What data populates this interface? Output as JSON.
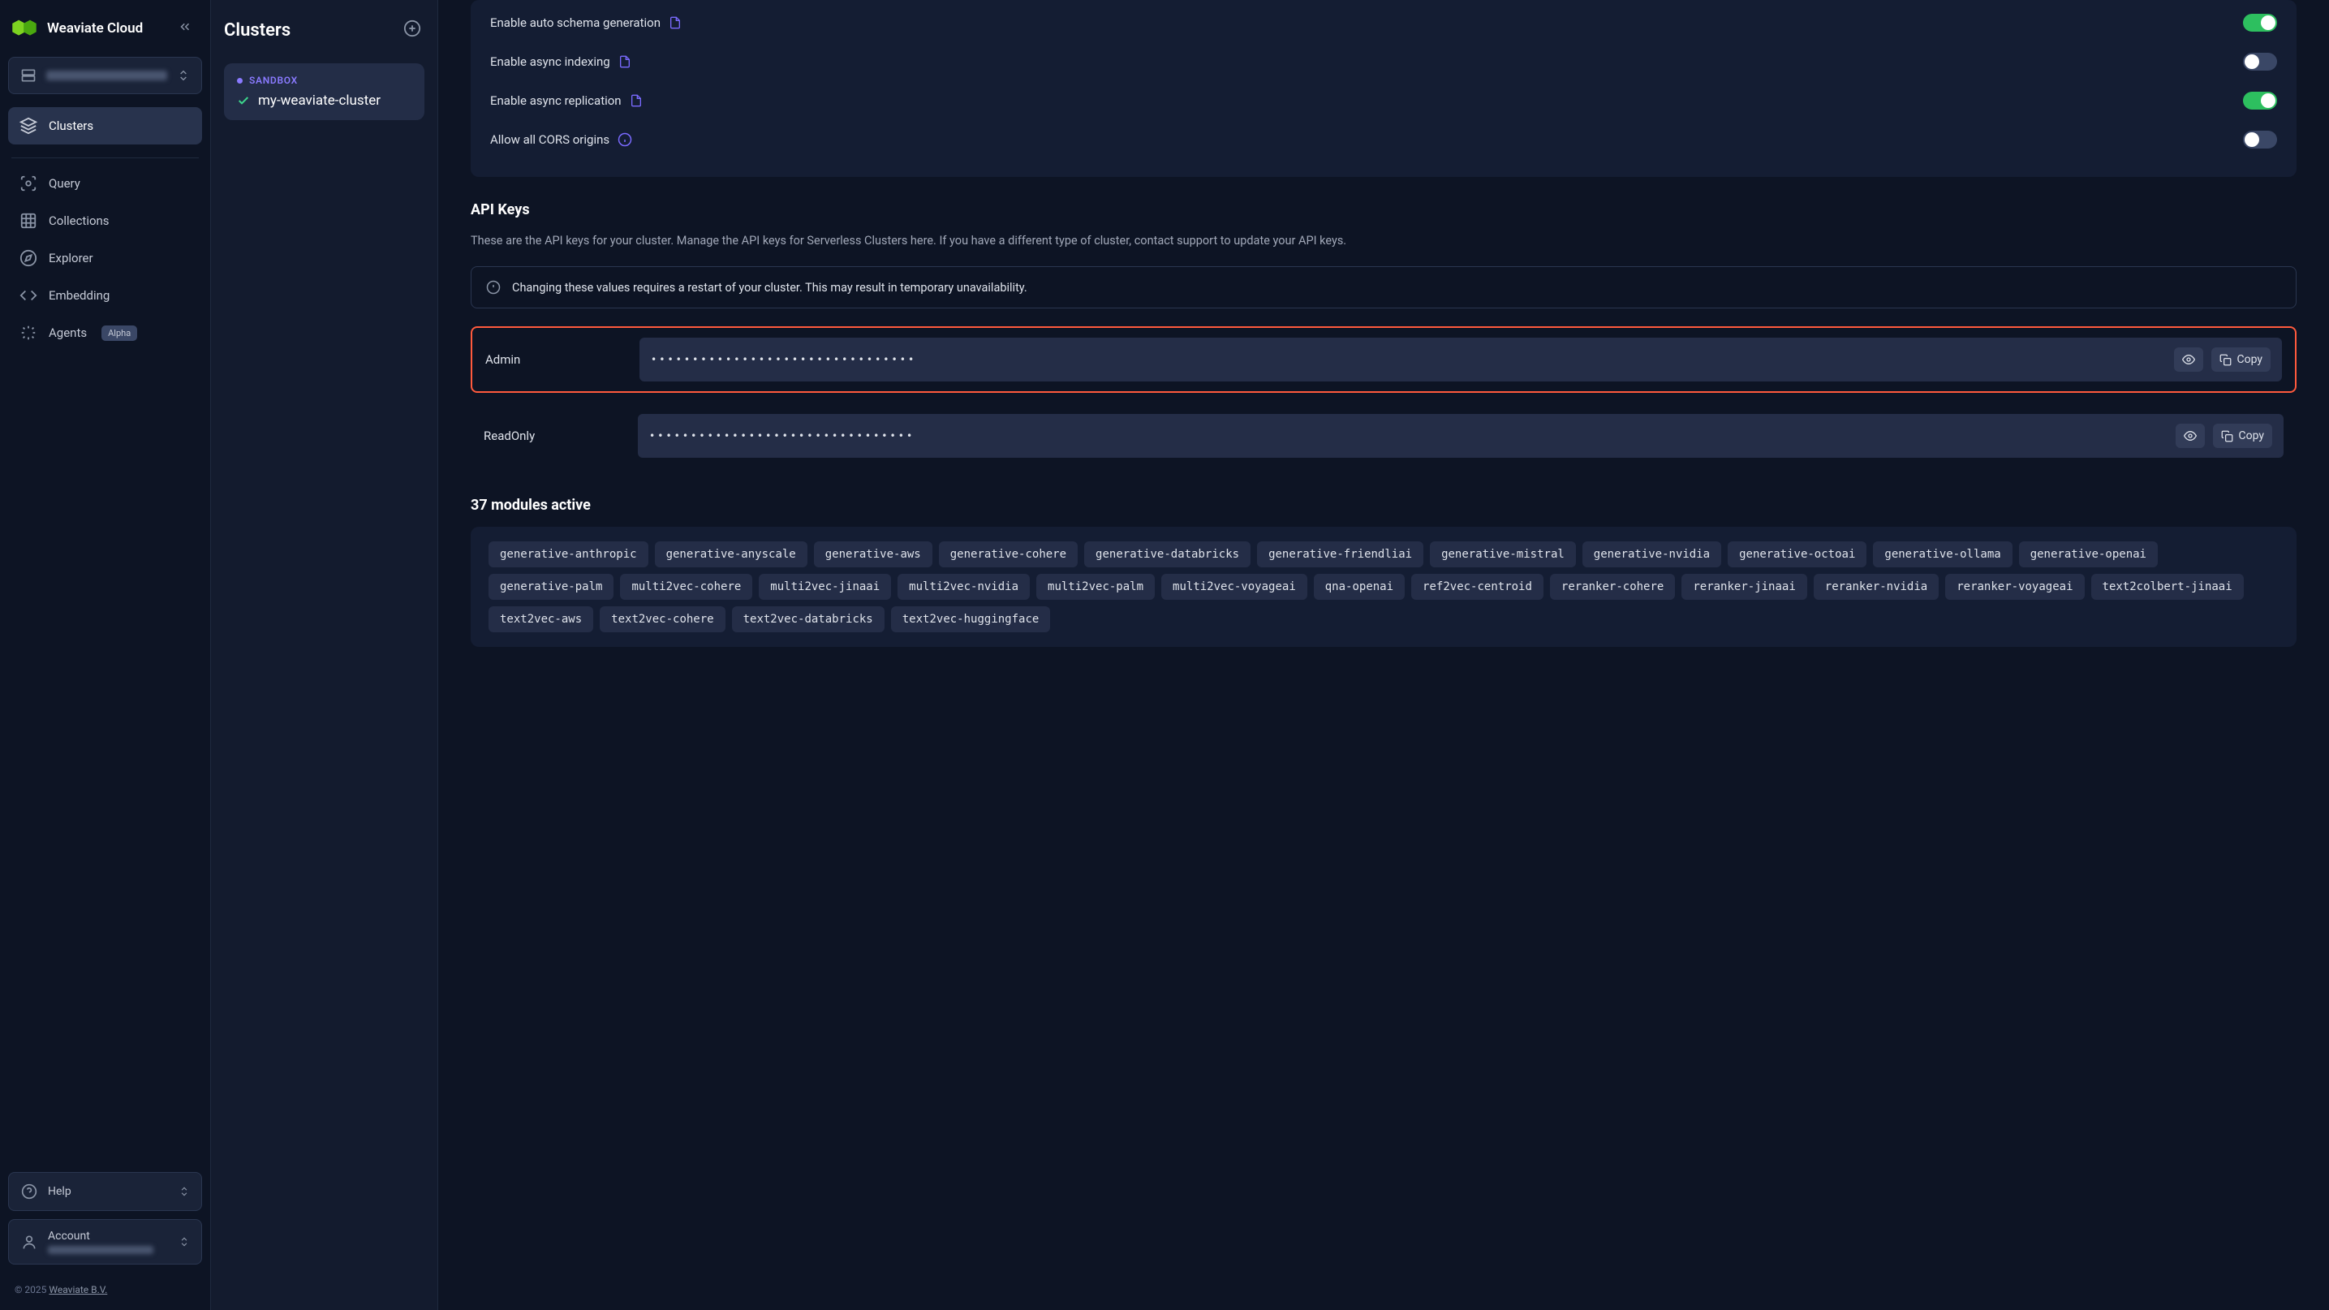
{
  "brand": "Weaviate Cloud",
  "sidebar": {
    "nav": [
      {
        "label": "Clusters",
        "icon": "layers"
      },
      {
        "label": "Query",
        "icon": "scan"
      },
      {
        "label": "Collections",
        "icon": "grid"
      },
      {
        "label": "Explorer",
        "icon": "compass"
      },
      {
        "label": "Embedding",
        "icon": "code"
      },
      {
        "label": "Agents",
        "icon": "sparkle",
        "badge": "Alpha"
      }
    ],
    "help": "Help",
    "account": "Account"
  },
  "copyright": {
    "prefix": "© 2025 ",
    "link": "Weaviate B.V."
  },
  "clusters_panel": {
    "title": "Clusters",
    "item": {
      "badge": "SANDBOX",
      "name": "my-weaviate-cluster"
    }
  },
  "settings": [
    {
      "label": "Enable auto schema generation",
      "icon": "doc",
      "on": true
    },
    {
      "label": "Enable async indexing",
      "icon": "doc",
      "on": false
    },
    {
      "label": "Enable async replication",
      "icon": "doc",
      "on": true
    },
    {
      "label": "Allow all CORS origins",
      "icon": "info",
      "on": false
    }
  ],
  "api_keys": {
    "title": "API Keys",
    "description": "These are the API keys for your cluster. Manage the API keys for Serverless Clusters here. If you have a different type of cluster, contact support to update your API keys.",
    "alert": "Changing these values requires a restart of your cluster. This may result in temporary unavailability.",
    "keys": [
      {
        "label": "Admin",
        "highlighted": true
      },
      {
        "label": "ReadOnly",
        "highlighted": false
      }
    ],
    "copy_label": "Copy",
    "masked": "••••••••••••••••••••••••••••••••"
  },
  "modules": {
    "title": "37 modules active",
    "tags": [
      "generative-anthropic",
      "generative-anyscale",
      "generative-aws",
      "generative-cohere",
      "generative-databricks",
      "generative-friendliai",
      "generative-mistral",
      "generative-nvidia",
      "generative-octoai",
      "generative-ollama",
      "generative-openai",
      "generative-palm",
      "multi2vec-cohere",
      "multi2vec-jinaai",
      "multi2vec-nvidia",
      "multi2vec-palm",
      "multi2vec-voyageai",
      "qna-openai",
      "ref2vec-centroid",
      "reranker-cohere",
      "reranker-jinaai",
      "reranker-nvidia",
      "reranker-voyageai",
      "text2colbert-jinaai",
      "text2vec-aws",
      "text2vec-cohere",
      "text2vec-databricks",
      "text2vec-huggingface"
    ]
  }
}
